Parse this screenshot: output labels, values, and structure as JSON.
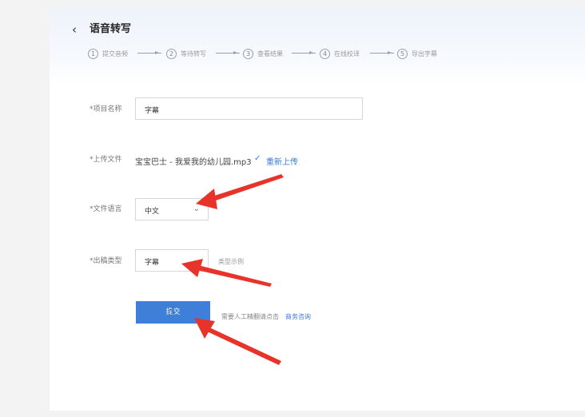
{
  "header": {
    "back_glyph": "‹",
    "title": "语音转写"
  },
  "steps": [
    {
      "num": "1",
      "label": "提交音频"
    },
    {
      "num": "2",
      "label": "等待转写"
    },
    {
      "num": "3",
      "label": "查看结果"
    },
    {
      "num": "4",
      "label": "在线校译"
    },
    {
      "num": "5",
      "label": "导出字幕"
    }
  ],
  "form": {
    "project_name": {
      "label": "*项目名称",
      "value": "字幕"
    },
    "upload_file": {
      "label": "*上传文件",
      "file_name": "宝宝巴士 - 我爱我的幼儿园.mp3",
      "check_glyph": "✓",
      "reupload_label": "重新上传"
    },
    "file_language": {
      "label": "*文件语言",
      "value": "中文"
    },
    "output_type": {
      "label": "*出稿类型",
      "value": "字幕",
      "example_link": "类型示例"
    },
    "submit_label": "提交",
    "hint_text": "需要人工精翻请点击",
    "hint_link": "商务咨询"
  },
  "icons": {
    "chevron": "⌄",
    "cursor": "☝"
  },
  "colors": {
    "accent": "#3d7fd9",
    "annotation_arrow": "#e8332b"
  }
}
